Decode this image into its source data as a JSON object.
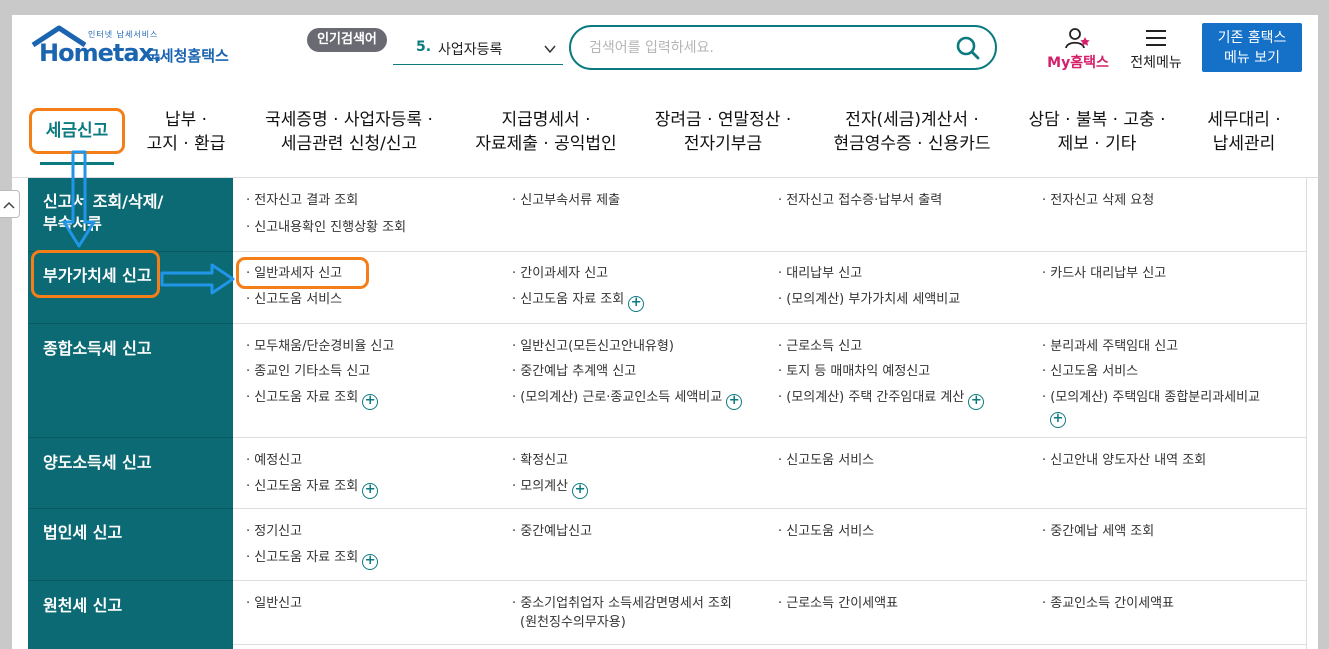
{
  "header": {
    "logo": {
      "small_text": "인터넷 납세서비스",
      "brand": "Hometax.",
      "korean_name": "국세청홈택스"
    },
    "popular": {
      "badge": "인기검색어",
      "rank": "5.",
      "keyword": "사업자등록"
    },
    "search": {
      "placeholder": "검색어를 입력하세요."
    },
    "my_hometax": "My홈택스",
    "all_menu": "전체메뉴",
    "old_home": {
      "line1": "기존 홈택스",
      "line2": "메뉴 보기"
    }
  },
  "gnb": [
    {
      "lines": [
        "세금신고"
      ],
      "active": true
    },
    {
      "lines": [
        "납부 ·",
        "고지 · 환급"
      ]
    },
    {
      "lines": [
        "국세증명 · 사업자등록 ·",
        "세금관련 신청/신고"
      ]
    },
    {
      "lines": [
        "지급명세서 ·",
        "자료제출 · 공익법인"
      ]
    },
    {
      "lines": [
        "장려금 · 연말정산 ·",
        "전자기부금"
      ]
    },
    {
      "lines": [
        "전자(세금)계산서 ·",
        "현금영수증 · 신용카드"
      ]
    },
    {
      "lines": [
        "상담 · 불복 · 고충 ·",
        "제보 · 기타"
      ]
    },
    {
      "lines": [
        "세무대리 ·",
        "납세관리"
      ]
    }
  ],
  "side_tab": "^",
  "categories": [
    {
      "title_lines": [
        "신고서 조회/삭제/",
        "부속서류"
      ],
      "links": [
        "· 전자신고 결과 조회",
        "· 신고부속서류 제출",
        "· 전자신고 접수증·납부서 출력",
        "· 전자신고 삭제 요청",
        "· 신고내용확인 진행상황 조회"
      ]
    },
    {
      "title_lines": [
        "부가가치세 신고"
      ],
      "links": [
        "· 일반과세자 신고",
        "· 간이과세자 신고",
        "· 대리납부 신고",
        "· 카드사 대리납부 신고",
        "· 신고도움 서비스",
        "· 신고도움 자료 조회",
        "· (모의계산) 부가가치세 세액비교"
      ]
    },
    {
      "title_lines": [
        "종합소득세 신고"
      ],
      "links": [
        "· 모두채움/단순경비율 신고",
        "· 일반신고(모든신고안내유형)",
        "· 근로소득 신고",
        "· 분리과세 주택임대 신고",
        "· 종교인 기타소득 신고",
        "· 중간예납 추계액 신고",
        "· 토지 등 매매차익 예정신고",
        "· 신고도움 서비스",
        "· 신고도움 자료 조회",
        "· (모의계산) 근로·종교인소득 세액비교",
        "· (모의계산) 주택 간주임대료 계산",
        "· (모의계산) 주택임대 종합분리과세비교"
      ]
    },
    {
      "title_lines": [
        "양도소득세 신고"
      ],
      "links": [
        "· 예정신고",
        "· 확정신고",
        "· 신고도움 서비스",
        "· 신고안내 양도자산 내역 조회",
        "· 신고도움 자료 조회",
        "· 모의계산"
      ]
    },
    {
      "title_lines": [
        "법인세 신고"
      ],
      "links": [
        "· 정기신고",
        "· 중간예납신고",
        "· 신고도움 서비스",
        "· 중간예납 세액 조회",
        "· 신고도움 자료 조회"
      ]
    },
    {
      "title_lines": [
        "원천세 신고"
      ],
      "links": [
        "· 일반신고",
        "· 중소기업취업자 소득세감면명세서 조회",
        "(원천징수의무자용)",
        "· 근로소득 간이세액표",
        "· 종교인소득 간이세액표"
      ]
    }
  ],
  "plus_symbol": "+",
  "colors": {
    "brand_teal": "#0c6a74",
    "accent_blue": "#1570c8",
    "highlight_orange": "#f47e17",
    "arrow_blue": "#2196e8",
    "my_pink": "#d4206a"
  }
}
